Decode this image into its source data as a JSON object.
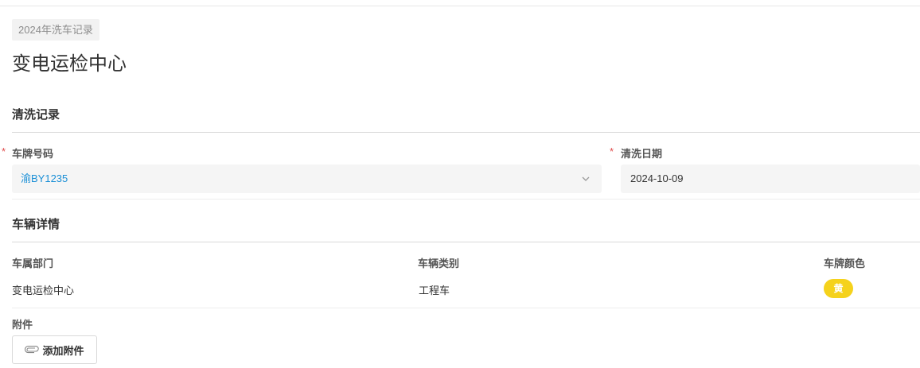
{
  "header": {
    "tag": "2024年洗车记录",
    "title": "变电运检中心"
  },
  "wash_record": {
    "section_title": "清洗记录",
    "plate_number": {
      "required_mark": "*",
      "label": "车牌号码",
      "value": "渝BY1235",
      "value_color": "#1a8fd6"
    },
    "wash_date": {
      "required_mark": "*",
      "label": "清洗日期",
      "value": "2024-10-09"
    }
  },
  "vehicle_details": {
    "section_title": "车辆详情",
    "department": {
      "label": "车属部门",
      "value": "变电运检中心"
    },
    "category": {
      "label": "车辆类别",
      "value": "工程车"
    },
    "plate_color": {
      "label": "车牌颜色",
      "value": "黄",
      "badge_color": "#f5d21c"
    }
  },
  "attachments": {
    "label": "附件",
    "add_button": {
      "label": "添加附件",
      "icon": "paperclip-icon"
    }
  }
}
